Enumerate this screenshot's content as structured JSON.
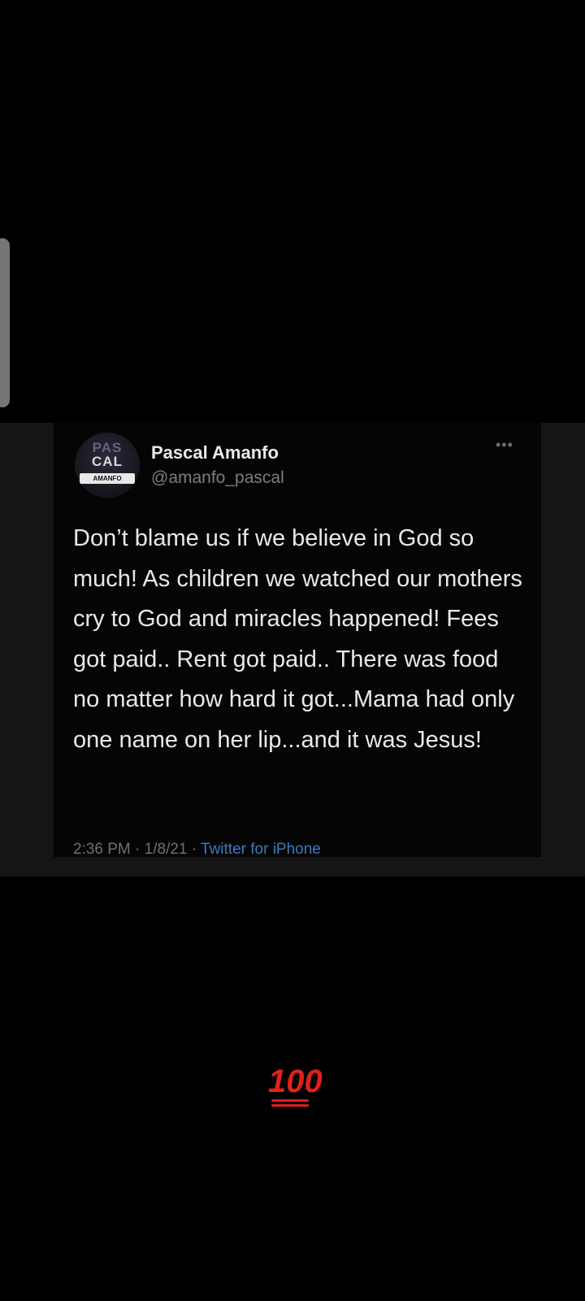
{
  "tweet": {
    "avatar": {
      "line1": "PAS",
      "line2": "CAL",
      "band": "AMANFO"
    },
    "display_name": "Pascal Amanfo",
    "handle": "@amanfo_pascal",
    "more_icon": "ellipsis-icon",
    "more_glyph": "•••",
    "text": "Don’t blame us if we believe in God so much! As children we watched our mothers cry to God and miracles happened! Fees got paid.. Rent got paid.. There was food no matter how hard it got...Mama had only one name on her lip...and it was Jesus!",
    "meta": {
      "time": "2:36 PM",
      "sep1": " · ",
      "date": "1/8/21",
      "sep2": " · ",
      "source": "Twitter for iPhone"
    }
  },
  "reaction": {
    "emoji_text": "100",
    "emoji_name": "hundred-points-icon",
    "color": "#e0201d"
  }
}
